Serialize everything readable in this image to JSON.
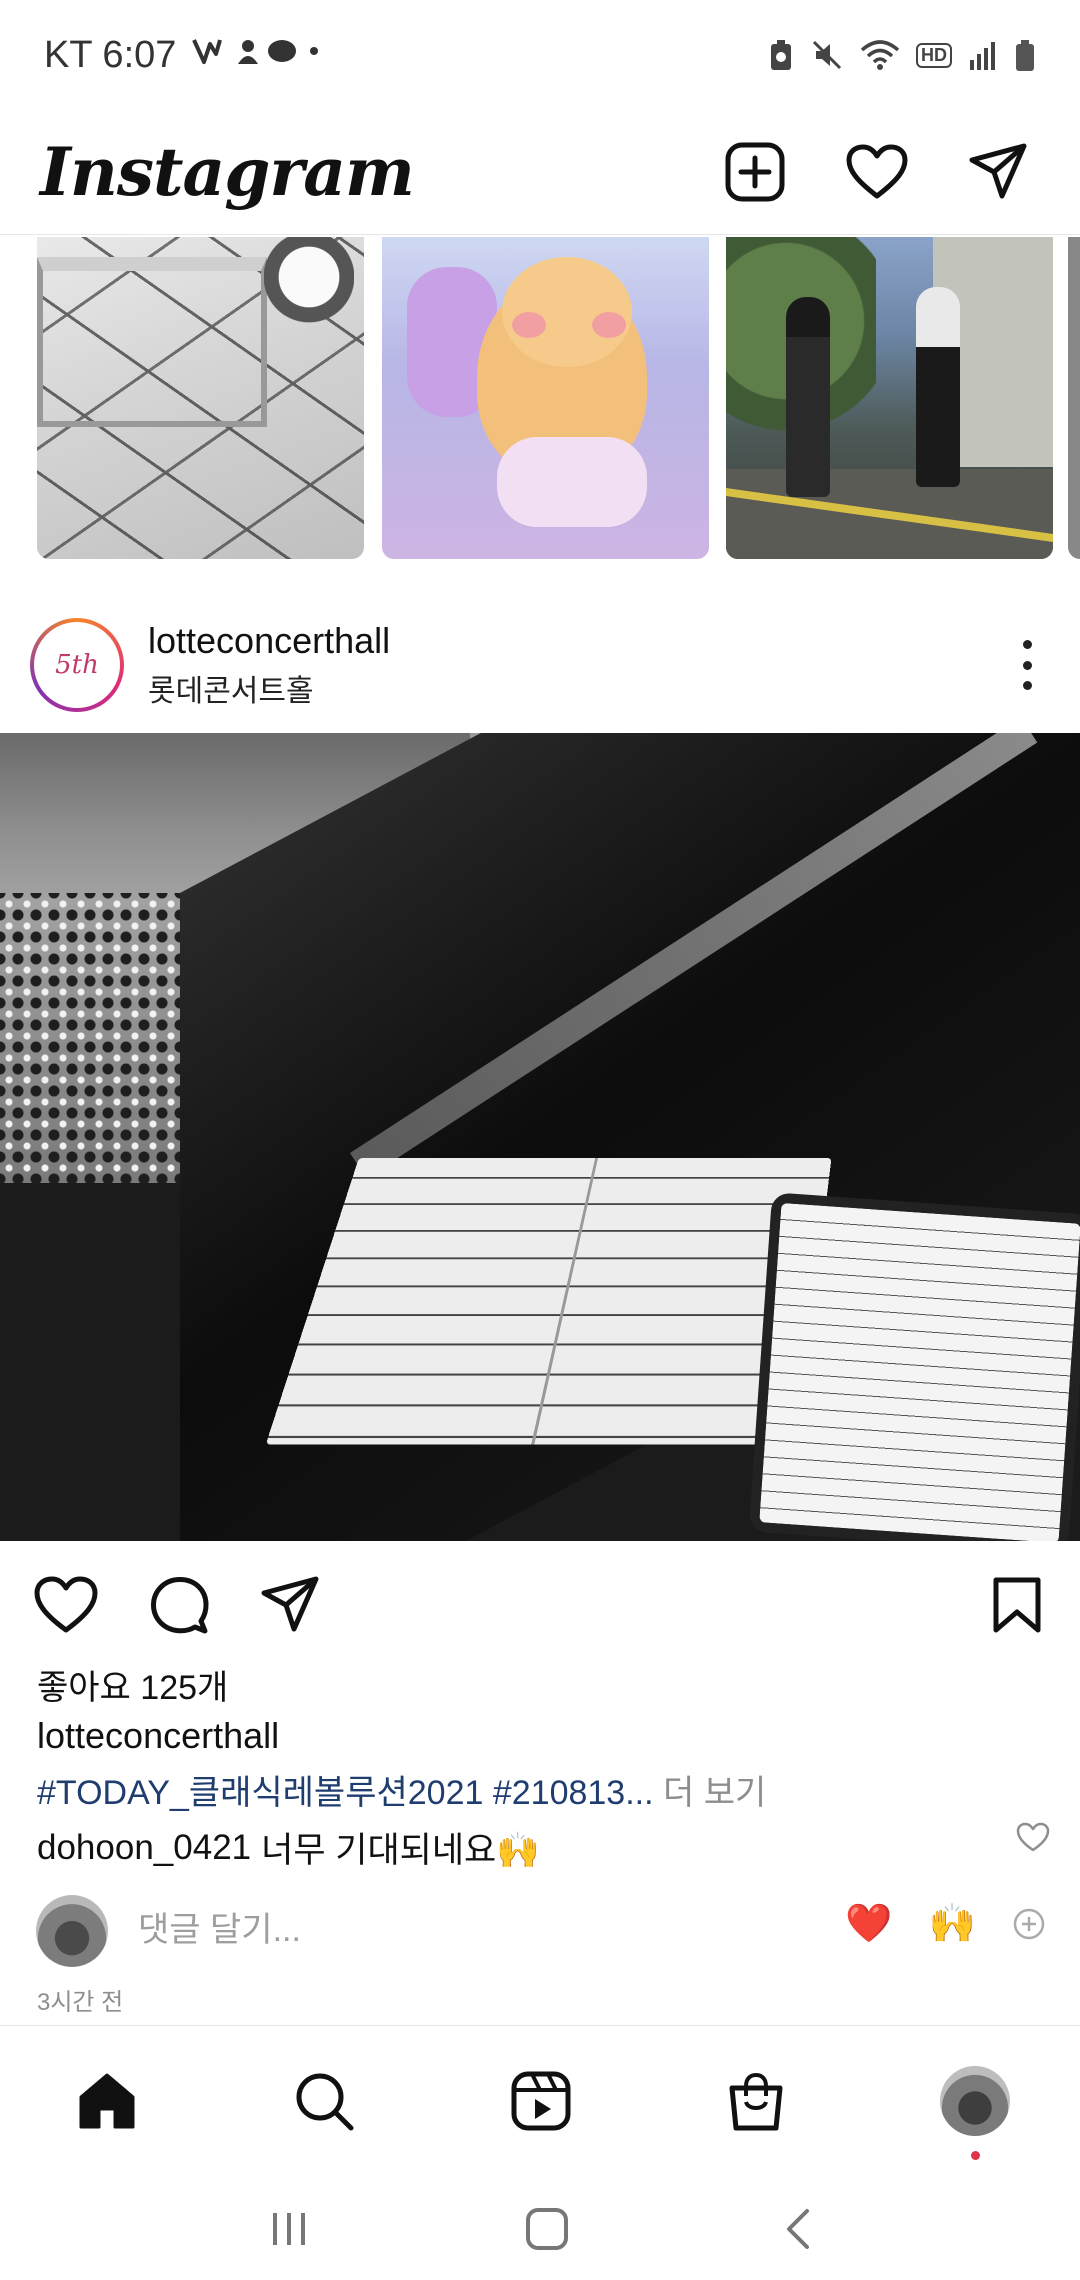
{
  "status_bar": {
    "carrier_time": "KT 6:07",
    "network_badge": "HD"
  },
  "header": {
    "logo": "Instagram",
    "icons": [
      "new-post-icon",
      "heart-icon",
      "direct-message-icon"
    ]
  },
  "reels": {
    "items": [
      "reel-thumbnail-cat-room",
      "reel-thumbnail-character",
      "reel-thumbnail-dancers"
    ]
  },
  "post": {
    "username": "lotteconcerthall",
    "location": "롯데콘서트홀",
    "image_description_icon": "photo",
    "likes": "좋아요 125개",
    "caption_user": "lotteconcerthall",
    "caption_tags": "#TODAY_클래식레볼루션2021 #210813...",
    "caption_more": " 더 보기",
    "comment_user": "dohoon_0421",
    "comment_text": "너무 기대되네요🙌",
    "add_comment_placeholder": "댓글 달기...",
    "quick_reactions": [
      "❤️",
      "🙌"
    ],
    "timestamp": "3시간 전"
  },
  "bottom_nav": {
    "items": [
      "home-icon",
      "search-icon",
      "reels-icon",
      "shop-icon",
      "profile-avatar"
    ]
  },
  "colors": {
    "hashtag": "#1f3d6e",
    "muted": "#8e8e8e",
    "notification_dot": "#e0334b"
  }
}
